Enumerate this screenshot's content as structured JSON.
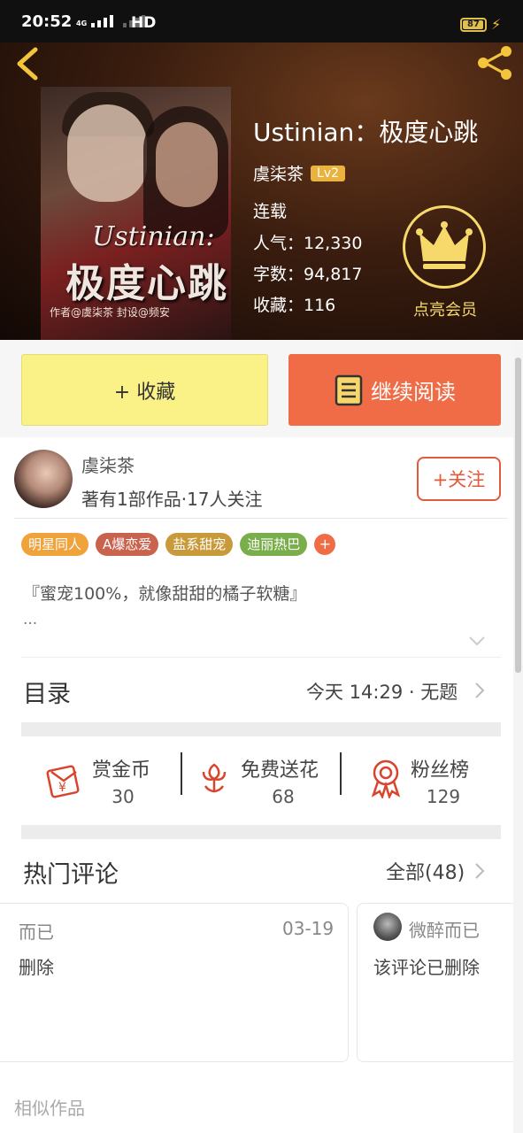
{
  "status_bar": {
    "time": "20:52",
    "network": "4G",
    "hd": "HD",
    "battery": "87"
  },
  "book": {
    "title": "Ustinian：极度心跳",
    "author": "虞柒茶",
    "author_level": "Lv2",
    "status": "连载",
    "popularity": "人气：12,330",
    "word_count": "字数：94,817",
    "favorites": "收藏：116",
    "cover": {
      "title_latin": "Ustinian:",
      "title_cn": "极度心跳",
      "byline": "作者@虞柒茶  封设@频安"
    }
  },
  "vip": {
    "label": "点亮会员"
  },
  "actions": {
    "collect_label": "+ 收藏",
    "read_label": "继续阅读"
  },
  "author_info": {
    "name": "虞柒茶",
    "stats": "著有1部作品·17人关注",
    "follow_label": "+关注"
  },
  "tags": [
    {
      "label": "明星同人",
      "color": "#f0a23b"
    },
    {
      "label": "A爆恋爱",
      "color": "#c9634e"
    },
    {
      "label": "盐系甜宠",
      "color": "#c99a3a"
    },
    {
      "label": "迪丽热巴",
      "color": "#7aae4a"
    }
  ],
  "tag_add": "+",
  "intro": {
    "text": "『蜜宠100%，就像甜甜的橘子软糖』",
    "more": "..."
  },
  "toc": {
    "title": "目录",
    "latest": "今天 14:29 · 无题"
  },
  "stats": [
    {
      "label": "赏金币",
      "value": "30",
      "icon": "red-envelope-icon"
    },
    {
      "label": "免费送花",
      "value": "68",
      "icon": "flower-icon"
    },
    {
      "label": "粉丝榜",
      "value": "129",
      "icon": "medal-icon"
    }
  ],
  "comments": {
    "title": "热门评论",
    "all_label": "全部(48)",
    "items": [
      {
        "name": "而已",
        "date": "03-19",
        "text": "删除"
      },
      {
        "name": "微醉而已",
        "text": "该评论已删除"
      }
    ]
  },
  "similar_title": "相似作品",
  "colors": {
    "accent": "#ef6c46",
    "collect_bg": "#fbf287",
    "vip_gold": "#f6d96a"
  }
}
